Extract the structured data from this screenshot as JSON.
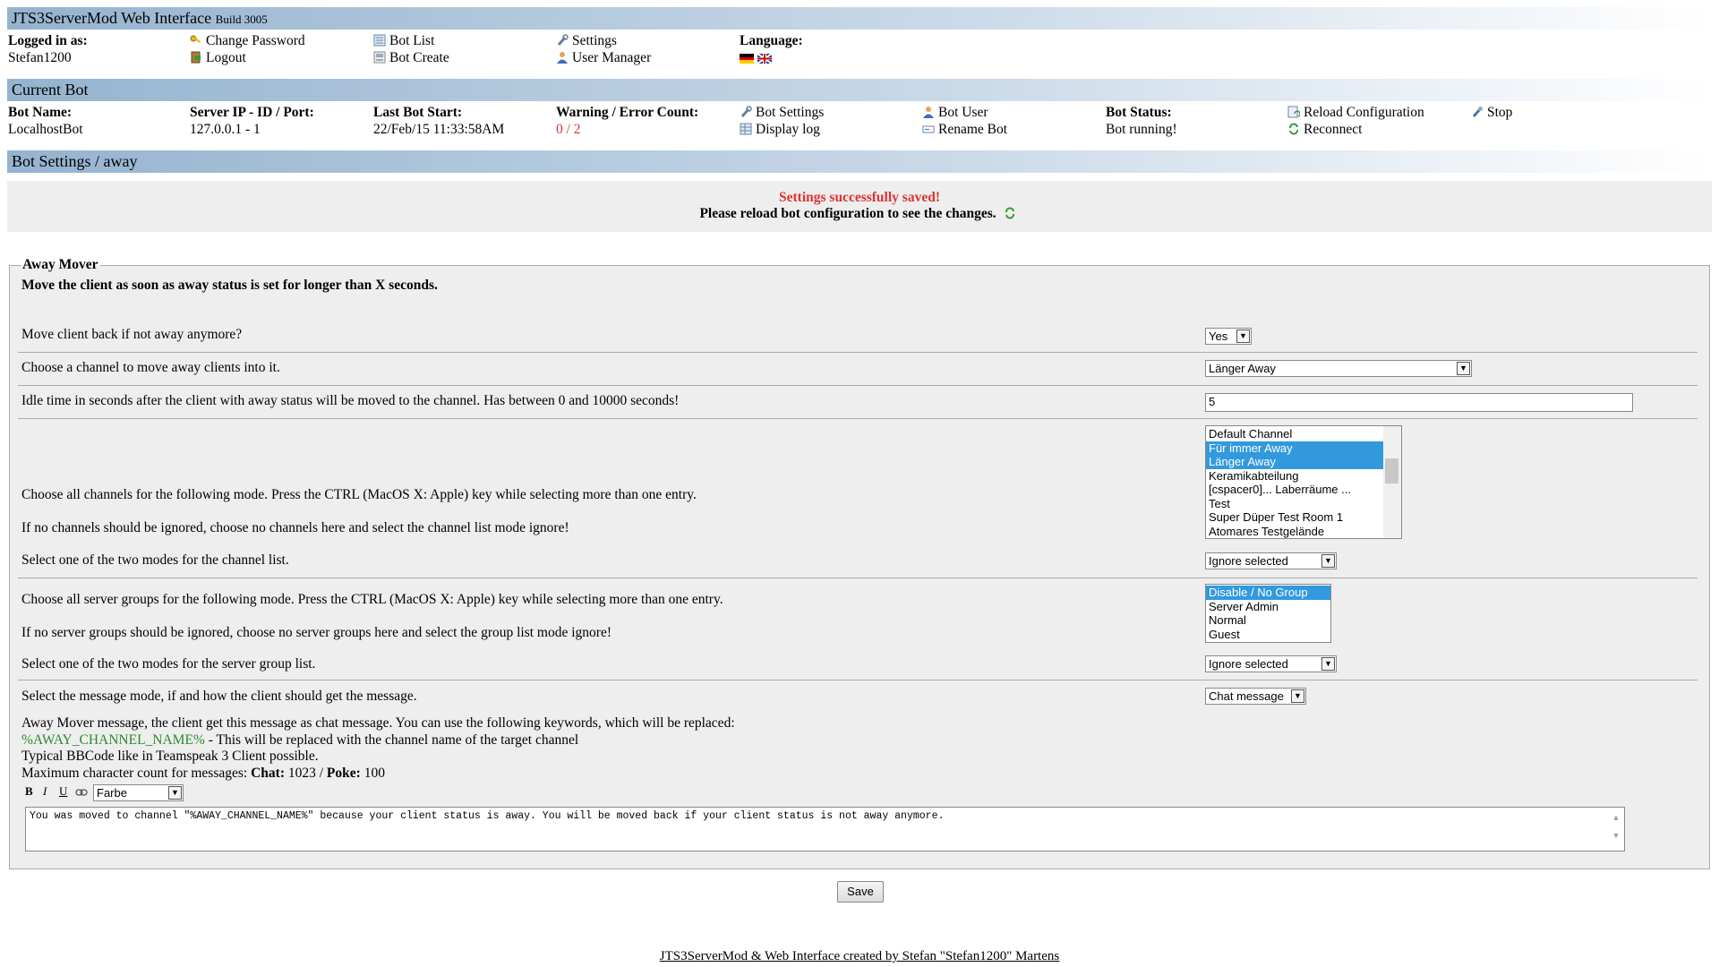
{
  "header": {
    "title": "JTS3ServerMod Web Interface",
    "build": "Build 3005",
    "logged_in_label": "Logged in as:",
    "user": "Stefan1200",
    "links": {
      "change_password": "Change Password",
      "logout": "Logout",
      "bot_list": "Bot List",
      "bot_create": "Bot Create",
      "settings": "Settings",
      "user_manager": "User Manager"
    },
    "language_label": "Language:"
  },
  "current_bot": {
    "section_title": "Current Bot",
    "bot_name_label": "Bot Name:",
    "bot_name": "LocalhostBot",
    "server_label": "Server IP - ID / Port:",
    "server": "127.0.0.1 - 1",
    "last_start_label": "Last Bot Start:",
    "last_start": "22/Feb/15 11:33:58AM",
    "warning_label": "Warning / Error Count:",
    "warning_count": "0 / 2",
    "links": {
      "bot_settings": "Bot Settings",
      "display_log": "Display log",
      "bot_user": "Bot User",
      "rename_bot": "Rename Bot",
      "reload_configuration": "Reload Configuration",
      "reconnect": "Reconnect",
      "stop": "Stop"
    },
    "status_label": "Bot Status:",
    "status": "Bot running!"
  },
  "settings_section": {
    "title": "Bot Settings / away",
    "success_msg": "Settings successfully saved!",
    "reload_msg": "Please reload bot configuration to see the changes."
  },
  "away_mover": {
    "legend": "Away Mover",
    "description": "Move the client as soon as away status is set for longer than X seconds.",
    "move_back_label": "Move client back if not away anymore?",
    "move_back_value": "Yes",
    "channel_label": "Choose a channel to move away clients into it.",
    "channel_value": "Länger Away",
    "idle_label": "Idle time in seconds after the client with away status will be moved to the channel. Has between 0 and 10000 seconds!",
    "idle_value": "5",
    "channels_label_1": "Choose all channels for the following mode. Press the CTRL (MacOS X: Apple) key while selecting more than one entry.",
    "channels_label_2": "If no channels should be ignored, choose no channels here and select the channel list mode ignore!",
    "channels": [
      {
        "label": "Default Channel",
        "selected": false
      },
      {
        "label": "Für immer Away",
        "selected": true
      },
      {
        "label": "Länger Away",
        "selected": true
      },
      {
        "label": "Keramikabteilung",
        "selected": false
      },
      {
        "label": "[cspacer0]... Laberräume ...",
        "selected": false
      },
      {
        "label": "Test",
        "selected": false
      },
      {
        "label": "Super Düper Test Room 1",
        "selected": false
      },
      {
        "label": "Atomares Testgelände",
        "selected": false
      }
    ],
    "channel_mode_label": "Select one of the two modes for the channel list.",
    "channel_mode_value": "Ignore selected",
    "groups_label_1": "Choose all server groups for the following mode. Press the CTRL (MacOS X: Apple) key while selecting more than one entry.",
    "groups_label_2": "If no server groups should be ignored, choose no server groups here and select the group list mode ignore!",
    "groups": [
      {
        "label": "Disable / No Group",
        "selected": true
      },
      {
        "label": "Server Admin",
        "selected": false
      },
      {
        "label": "Normal",
        "selected": false
      },
      {
        "label": "Guest",
        "selected": false
      }
    ],
    "group_mode_label": "Select one of the two modes for the server group list.",
    "group_mode_value": "Ignore selected",
    "message_mode_label": "Select the message mode, if and how the client should get the message.",
    "message_mode_value": "Chat message",
    "message_help_1": "Away Mover message, the client get this message as chat message. You can use the following keywords, which will be replaced:",
    "keyword": "%AWAY_CHANNEL_NAME%",
    "keyword_desc": " - This will be replaced with the channel name of the target channel",
    "bbcode_note": "Typical BBCode like in Teamspeak 3 Client possible.",
    "max_count_prefix": "Maximum character count for messages:",
    "chat_label": "Chat:",
    "chat_count": "1023",
    "poke_label": "Poke:",
    "poke_count": "100",
    "format_buttons": {
      "bold": "B",
      "italic": "I",
      "underline": "U"
    },
    "color_select": "Farbe",
    "message_text": "You was moved to channel \"%AWAY_CHANNEL_NAME%\" because your client status is away. You will be moved back if your client status is not away anymore."
  },
  "save_button": "Save",
  "footer": "JTS3ServerMod & Web Interface created by Stefan \"Stefan1200\" Martens",
  "colors": {
    "header_bar": "#95b3cf",
    "error_red": "#dd3333",
    "keyword_green": "#2a8a2a",
    "selection_blue": "#3399dd"
  }
}
